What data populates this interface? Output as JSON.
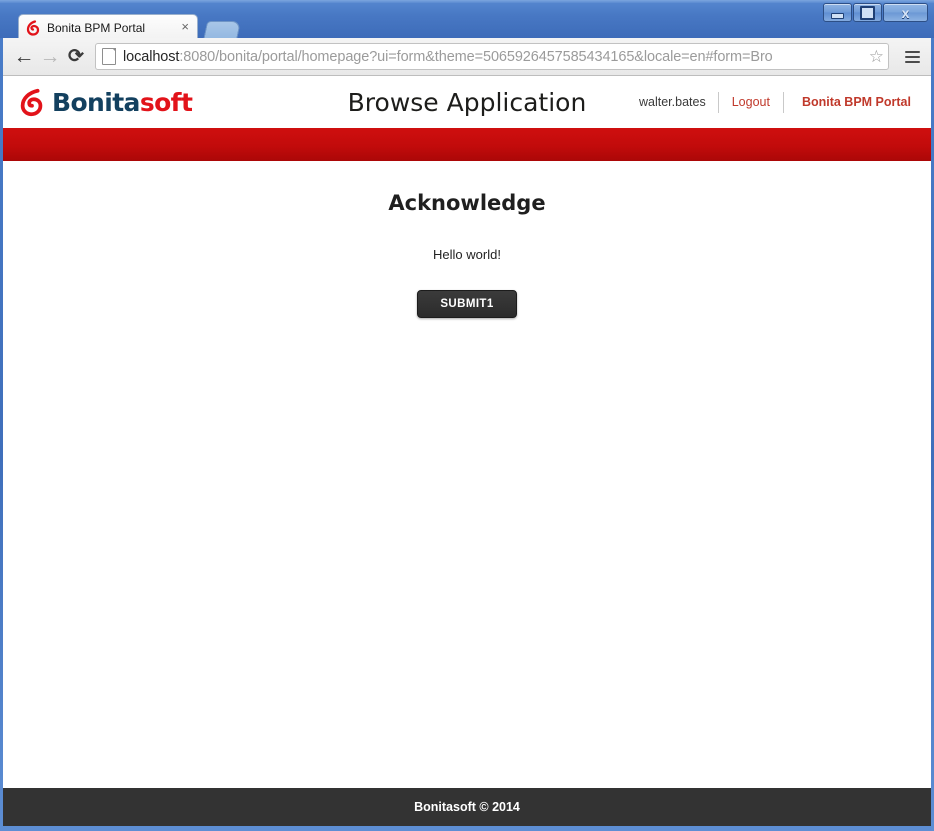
{
  "window": {
    "minimize_label": "Minimize",
    "maximize_label": "Maximize",
    "close_label": "x"
  },
  "browser": {
    "tab": {
      "title": "Bonita BPM Portal",
      "close_label": "×",
      "favicon": "bonita-favicon"
    },
    "new_tab_label": "New Tab",
    "back_label": "←",
    "forward_label": "→",
    "reload_label": "⟳",
    "url_host": "localhost",
    "url_rest": ":8080/bonita/portal/homepage?ui=form&theme=5065926457585434165&locale=en#form=Bro",
    "bookmark_label": "☆",
    "menu_label": "Menu"
  },
  "header": {
    "logo_first": "Bonita",
    "logo_second": "soft",
    "app_title": "Browse Application",
    "user_name": "walter.bates",
    "logout_label": "Logout",
    "portal_link_label": "Bonita BPM Portal",
    "band_color": "#c20b0b"
  },
  "content": {
    "form_title": "Acknowledge",
    "message": "Hello world!",
    "submit_label": "SUBMIT1"
  },
  "footer": {
    "copyright": "Bonitasoft © 2014"
  }
}
